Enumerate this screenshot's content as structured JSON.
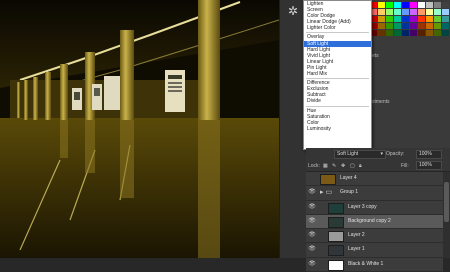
{
  "blend_modes": [
    {
      "label": "Lighten"
    },
    {
      "label": "Screen"
    },
    {
      "label": "Color Dodge"
    },
    {
      "label": "Linear Dodge (Add)"
    },
    {
      "label": "Lighter Color"
    },
    {
      "sep": true
    },
    {
      "label": "Overlay"
    },
    {
      "label": "Soft Light",
      "selected": true
    },
    {
      "label": "Hard Light"
    },
    {
      "label": "Vivid Light"
    },
    {
      "label": "Linear Light"
    },
    {
      "label": "Pin Light"
    },
    {
      "label": "Hard Mix"
    },
    {
      "sep": true
    },
    {
      "label": "Difference"
    },
    {
      "label": "Exclusion"
    },
    {
      "label": "Subtract"
    },
    {
      "label": "Divide"
    },
    {
      "sep": true
    },
    {
      "label": "Hue"
    },
    {
      "label": "Saturation"
    },
    {
      "label": "Color"
    },
    {
      "label": "Luminosity"
    }
  ],
  "layers_panel": {
    "blend_mode": "Soft Light",
    "opacity_label": "Opacity:",
    "opacity_value": "100%",
    "lock_label": "Lock:",
    "fill_label": "Fill:",
    "fill_value": "100%"
  },
  "layers": [
    {
      "name": "Layer 4",
      "thumb": "#7a5a16",
      "visible": false,
      "indent": 0
    },
    {
      "name": "Group 1",
      "thumb": "folder",
      "visible": true,
      "indent": 0
    },
    {
      "name": "Layer 3 copy",
      "thumb": "#1f3f3a",
      "visible": true,
      "indent": 1
    },
    {
      "name": "Background copy 2",
      "thumb": "#2a3a36",
      "visible": true,
      "indent": 1,
      "active": true
    },
    {
      "name": "Layer 2",
      "thumb": "#9a9a9a",
      "visible": true,
      "indent": 1
    },
    {
      "name": "Layer 1",
      "thumb": "#30363a",
      "visible": true,
      "indent": 1
    },
    {
      "name": "Black & White 1",
      "thumb": "#ffffff",
      "visible": true,
      "indent": 1
    }
  ],
  "swatch_colors": [
    "#ff0000",
    "#ffff00",
    "#00ff00",
    "#00ffff",
    "#0000ff",
    "#ff00ff",
    "#ffffff",
    "#c0c0c0",
    "#808080",
    "#404040",
    "#000000",
    "#ff6666",
    "#ffcc66",
    "#99ff66",
    "#66ffcc",
    "#6699ff",
    "#cc66ff",
    "#ff9966",
    "#ffff99",
    "#99ffcc",
    "#99ccff",
    "#cc99ff",
    "#cc0000",
    "#cc9900",
    "#33cc00",
    "#00cc99",
    "#0033cc",
    "#9900cc",
    "#ff3300",
    "#ff9900",
    "#66cc33",
    "#339999",
    "#663399",
    "#990000",
    "#996600",
    "#339900",
    "#009966",
    "#003399",
    "#660099",
    "#993300",
    "#cc6600",
    "#669900",
    "#006666",
    "#330066",
    "#660000",
    "#663300",
    "#336600",
    "#006633",
    "#002266",
    "#440066",
    "#552200",
    "#885500",
    "#446600",
    "#004444",
    "#220044"
  ],
  "side_tabs": [
    "ets",
    "stments"
  ]
}
